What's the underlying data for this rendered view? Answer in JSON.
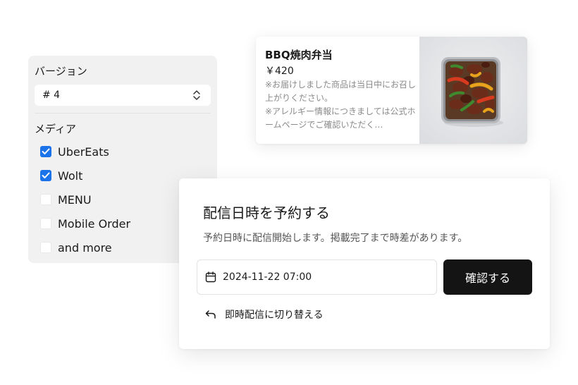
{
  "version_panel": {
    "label": "バージョン",
    "selected_version": "# 4",
    "select_icon": "chevron-up-down-icon",
    "media_label": "メディア",
    "media_options": [
      {
        "label": "UberEats",
        "checked": true
      },
      {
        "label": "Wolt",
        "checked": true
      },
      {
        "label": "MENU",
        "checked": false
      },
      {
        "label": "Mobile Order",
        "checked": false
      },
      {
        "label": "and more",
        "checked": false
      }
    ]
  },
  "product": {
    "name": "BBQ焼肉弁当",
    "price": "￥420",
    "description_1": "※お届けしました商品は当日中にお召し上がりください。",
    "description_2": "※アレルギー情報につきましては公式ホームページでご確認いただく…",
    "image": "bbq-bento-photo"
  },
  "schedule": {
    "title": "配信日時を予約する",
    "description": "予約日時に配信開始します。掲載完了まで時差があります。",
    "datetime_value": "2024-11-22 07:00",
    "datetime_icon": "calendar-icon",
    "confirm_label": "確認する",
    "switch_label": "即時配信に切り替える",
    "switch_icon": "undo-arrow-icon"
  },
  "colors": {
    "checkbox_accent": "#1a73e8",
    "button_bg": "#141414",
    "panel_bg": "#f1f1f1"
  }
}
